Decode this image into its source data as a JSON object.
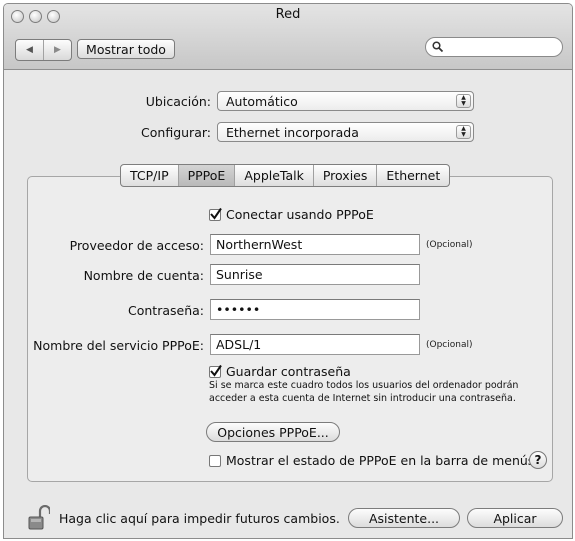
{
  "window": {
    "title": "Red"
  },
  "toolbar": {
    "show_all_label": "Mostrar todo",
    "search_placeholder": ""
  },
  "location": {
    "label": "Ubicación:",
    "value": "Automático"
  },
  "configure": {
    "label": "Configurar:",
    "value": "Ethernet incorporada"
  },
  "tabs": [
    {
      "label": "TCP/IP",
      "active": false
    },
    {
      "label": "PPPoE",
      "active": true
    },
    {
      "label": "AppleTalk",
      "active": false
    },
    {
      "label": "Proxies",
      "active": false
    },
    {
      "label": "Ethernet",
      "active": false
    }
  ],
  "pppoe": {
    "connect_label": "Conectar usando PPPoE",
    "connect_checked": true,
    "provider_label": "Proveedor de acceso:",
    "provider_value": "NorthernWest",
    "optional_label": "(Opcional)",
    "account_label": "Nombre de cuenta:",
    "account_value": "Sunrise",
    "password_label": "Contraseña:",
    "password_value": "••••••",
    "service_label": "Nombre del servicio PPPoE:",
    "service_value": "ADSL/1",
    "save_password_label": "Guardar contraseña",
    "save_password_checked": true,
    "save_password_note_1": "Si se marca este cuadro todos los usuarios del ordenador podrán",
    "save_password_note_2": "acceder a esta cuenta de Internet sin introducir una contraseña.",
    "options_button": "Opciones PPPoE...",
    "show_status_label": "Mostrar el estado de PPPoE en la barra de menús",
    "show_status_checked": false,
    "help_glyph": "?"
  },
  "footer": {
    "lock_text": "Haga clic aquí para impedir futuros cambios.",
    "assistant_button": "Asistente...",
    "apply_button": "Aplicar"
  },
  "icons": [
    "close-icon",
    "minimize-icon",
    "zoom-icon",
    "back-icon",
    "forward-icon",
    "search-icon",
    "checkmark-icon",
    "lock-icon",
    "help-icon"
  ]
}
